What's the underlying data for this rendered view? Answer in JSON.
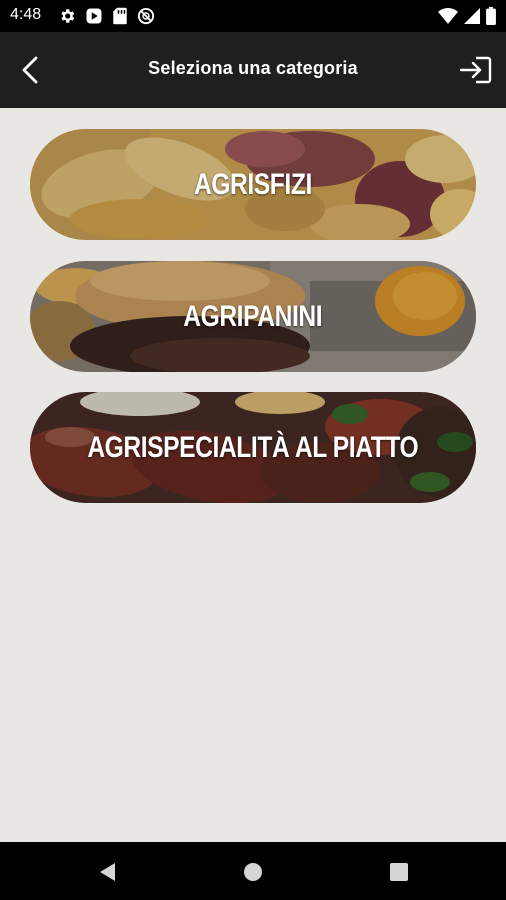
{
  "status_bar": {
    "time": "4:48",
    "left_icons": [
      "gear-icon",
      "play-icon",
      "sd-card-icon",
      "no-disturb-icon"
    ],
    "right_icons": [
      "wifi-icon",
      "signal-icon",
      "battery-icon"
    ]
  },
  "app_bar": {
    "title": "Seleziona una categoria",
    "back_icon": "chevron-left-icon",
    "login_icon": "login-icon"
  },
  "categories": [
    {
      "label": "AGRISFIZI",
      "image": "fries-and-sausage-photo"
    },
    {
      "label": "AGRIPANINI",
      "image": "burger-sandwich-photo"
    },
    {
      "label": "AGRISPECIALITÀ AL PIATTO",
      "image": "grilled-sausages-photo"
    }
  ],
  "nav_bar": {
    "buttons": [
      "back-triangle-icon",
      "home-circle-icon",
      "recents-square-icon"
    ]
  },
  "colors": {
    "app_bar": "#1f1f1f",
    "background": "#e9e7e3",
    "status_bar": "#000000"
  }
}
